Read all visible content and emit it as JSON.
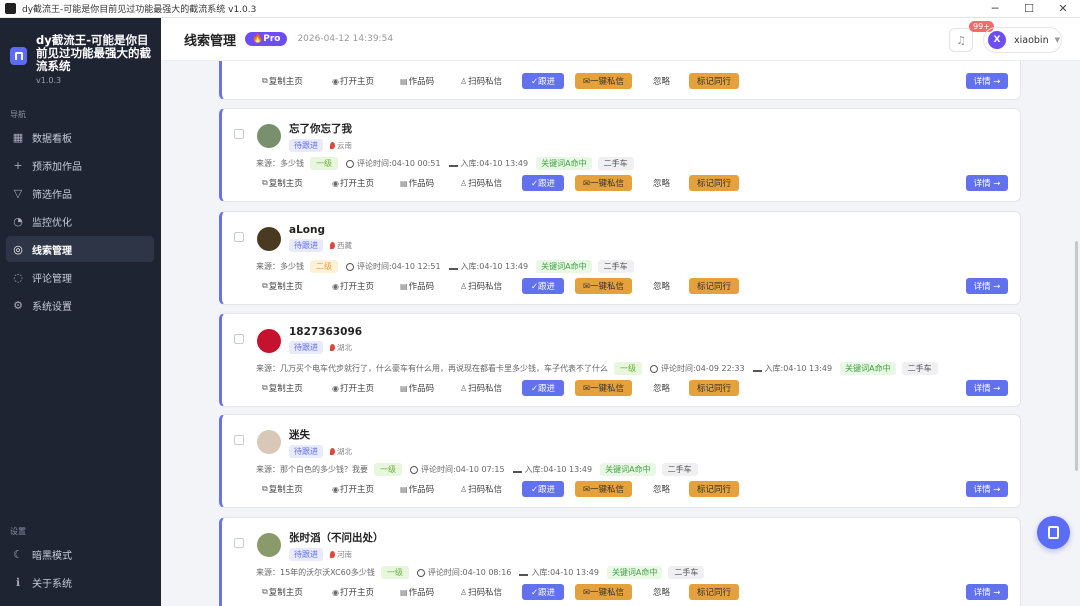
{
  "window": {
    "title": "dy截流王-可能是你目前见过功能最强大的截流系统 v1.0.3",
    "min": "─",
    "max": "☐",
    "close": "✕"
  },
  "brand": {
    "name": "dy截流王-可能是你目前见过功能最强大的截流系统",
    "version": "v1.0.3"
  },
  "nav": {
    "section": "导航",
    "items": [
      {
        "label": "数据看板",
        "icon": "chart-icon",
        "glyph": "▦"
      },
      {
        "label": "预添加作品",
        "icon": "plus-icon",
        "glyph": "+"
      },
      {
        "label": "筛选作品",
        "icon": "filter-icon",
        "glyph": "▽"
      },
      {
        "label": "监控优化",
        "icon": "gauge-icon",
        "glyph": "◔"
      },
      {
        "label": "线索管理",
        "icon": "target-icon",
        "glyph": "◎"
      },
      {
        "label": "评论管理",
        "icon": "comment-icon",
        "glyph": "◌"
      },
      {
        "label": "系统设置",
        "icon": "gear-icon",
        "glyph": "⚙"
      }
    ]
  },
  "settings": {
    "section": "设置",
    "items": [
      {
        "label": "暗黑模式",
        "icon": "moon-icon",
        "glyph": "☾"
      },
      {
        "label": "关于系统",
        "icon": "info-icon",
        "glyph": "ℹ"
      }
    ]
  },
  "header": {
    "title": "线索管理",
    "pro": "🔥Pro",
    "time": "2026-04-12 14:39:54",
    "badge": "99+",
    "user_initial": "X",
    "username": "xiaobin"
  },
  "labels": {
    "source_prefix": "来源：",
    "comment_time": "评论时间: ",
    "stored": "入库: ",
    "copy_home": "复制主页",
    "open_home": "打开主页",
    "works_code": "作品码",
    "scan_msg": "扫码私信",
    "follow": "✓跟进",
    "one_click_msg": "✉一键私信",
    "ignore": "忽略",
    "mark_peer": "标记同行",
    "detail": "详情 →"
  },
  "leads": [
    {
      "name": "",
      "status": "",
      "location": "",
      "source": "",
      "level": "",
      "level_class": "lv1",
      "comment_time": "",
      "stored_time": "",
      "keyword": "",
      "category": ""
    },
    {
      "name": "忘了你忘了我",
      "status": "待跟进",
      "location": "云南",
      "source": "多少钱",
      "level": "一级",
      "level_class": "lv1",
      "comment_time": "04-10 00:51",
      "stored_time": "04-10 13:49",
      "keyword": "关键词A命中",
      "category": "二手车",
      "avatar_color": "#7a8f6b"
    },
    {
      "name": "aLong",
      "status": "待跟进",
      "location": "西藏",
      "source": "多少钱",
      "level": "二级",
      "level_class": "lv2",
      "comment_time": "04-10 12:51",
      "stored_time": "04-10 13:49",
      "keyword": "关键词A命中",
      "category": "二手车",
      "avatar_color": "#4a3a22"
    },
    {
      "name": "1827363096",
      "status": "待跟进",
      "location": "湖北",
      "source": "几万买个电车代步就行了，什么豪车有什么用，再说现在都看卡里多少钱，车子代表不了什么",
      "level": "一级",
      "level_class": "lv1",
      "comment_time": "04-09 22:33",
      "stored_time": "04-10 13:49",
      "keyword": "关键词A命中",
      "category": "二手车",
      "avatar_color": "#c4122f"
    },
    {
      "name": "迷失",
      "status": "待跟进",
      "location": "湖北",
      "source": "那个白色的多少钱？我要",
      "level": "一级",
      "level_class": "lv1",
      "comment_time": "04-10 07:15",
      "stored_time": "04-10 13:49",
      "keyword": "关键词A命中",
      "category": "二手车",
      "avatar_color": "#d9c7b8"
    },
    {
      "name": "张时滔（不问出处）",
      "status": "待跟进",
      "location": "河南",
      "source": "15年的沃尔沃XC60多少钱",
      "level": "一级",
      "level_class": "lv1",
      "comment_time": "04-10 08:16",
      "stored_time": "04-10 13:49",
      "keyword": "关键词A命中",
      "category": "二手车",
      "avatar_color": "#8a9a6a"
    }
  ]
}
